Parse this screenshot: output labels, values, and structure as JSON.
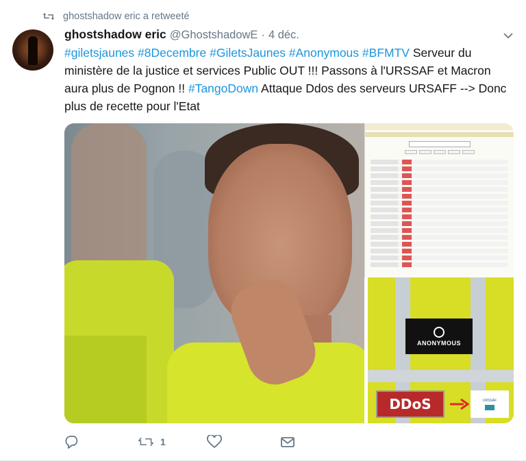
{
  "retweet_notice": {
    "text": "ghostshadow eric a retweeté",
    "icon": "retweet-icon"
  },
  "author": {
    "name": "ghostshadow eric",
    "handle": "@GhostshadowE",
    "separator": "·",
    "date": "4 déc."
  },
  "tweet": {
    "hashtags_line": [
      "#giletsjaunes",
      "#8Decembre",
      "#GiletsJaunes",
      "#Anonymous",
      "#BFMTV"
    ],
    "text_1": "Serveur du ministère de la justice  et services Public OUT !!! Passons à l'URSSAF et Macron aura plus de Pognon !! ",
    "tag_tango": "#TangoDown",
    "text_2": " Attaque Ddos des  serveurs URSAFF  --> Donc plus de  recette pour l'Etat"
  },
  "media": {
    "anon_label": "ANONYMOUS",
    "ddos_label": "DDoS",
    "urssaf_label": "URSSAF"
  },
  "actions": {
    "reply_icon": "reply-icon",
    "retweet_icon": "retweet-icon",
    "retweet_count": "1",
    "like_icon": "heart-icon",
    "dm_icon": "envelope-icon"
  },
  "colors": {
    "link": "#1b95e0",
    "muted": "#657786",
    "text": "#14171a"
  }
}
